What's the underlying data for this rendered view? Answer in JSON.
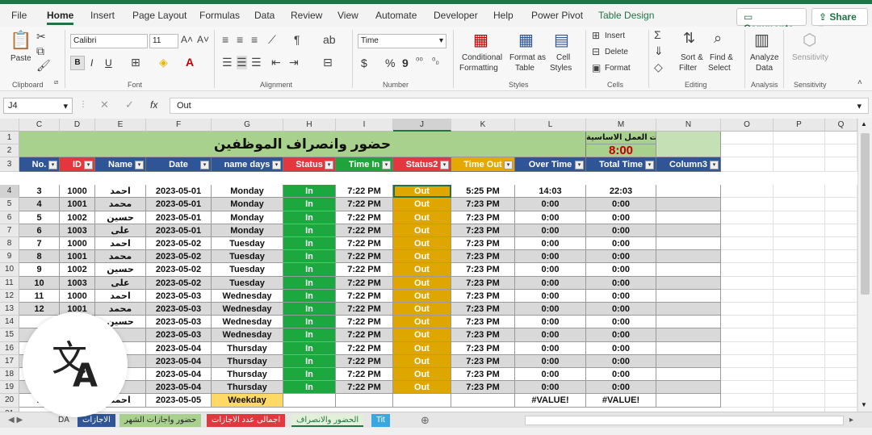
{
  "colors": {
    "brand": "#217346",
    "title_bg": "#a9d18e",
    "hdr_red": "#e2373f",
    "hdr_blue": "#2f5597",
    "hdr_green": "#1fa33a",
    "hdr_gold": "#e6a800",
    "in_green": "#1aa83f",
    "out_gold": "#e0a600",
    "pink": "#fbe3ea",
    "total_red": "#c00000"
  },
  "menu": {
    "tabs": [
      "File",
      "Home",
      "Insert",
      "Page Layout",
      "Formulas",
      "Data",
      "Review",
      "View",
      "Automate",
      "Developer",
      "Help",
      "Power Pivot",
      "Table Design"
    ],
    "comments": "Comments",
    "share": "Share"
  },
  "ribbon": {
    "clipboard": {
      "paste": "Paste",
      "label": "Clipboard"
    },
    "font": {
      "name": "Calibri",
      "size": "11",
      "label": "Font",
      "bold": "B",
      "italic": "I",
      "underline": "U"
    },
    "alignment": {
      "label": "Alignment"
    },
    "number": {
      "format": "Time",
      "currency": "$",
      "percent": "%",
      "comma": "9",
      "label": "Number"
    },
    "styles": {
      "conditional": "Conditional",
      "formatting": "Formatting",
      "format_as": "Format as",
      "table": "Table",
      "cell": "Cell",
      "cell_styles": "Styles",
      "label": "Styles"
    },
    "cells": {
      "insert": "Insert",
      "delete": "Delete",
      "format": "Format",
      "label": "Cells"
    },
    "editing": {
      "sort": "Sort &",
      "filter": "Filter",
      "find": "Find &",
      "select": "Select",
      "label": "Editing"
    },
    "analysis": {
      "analyze": "Analyze",
      "data": "Data",
      "label": "Analysis"
    },
    "sensitivity": {
      "name": "Sensitivity",
      "label": "Sensitivity"
    }
  },
  "formula_bar": {
    "name_box": "J4",
    "fx": "fx",
    "value": "Out"
  },
  "columns": [
    "C",
    "D",
    "E",
    "F",
    "G",
    "H",
    "I",
    "J",
    "K",
    "L",
    "M",
    "N",
    "O",
    "P",
    "Q"
  ],
  "sheet": {
    "title": "حضور وانصراف الموظفين",
    "total_label": "اجمالى ساعات العمل الاساسية",
    "total_value": "8:00",
    "headers": [
      "No.",
      "ID",
      "Name",
      "Date",
      "name days",
      "Status",
      "Time In",
      "Status2",
      "Time Out",
      "Over Time",
      "Total Time",
      "Column3"
    ],
    "rows": [
      {
        "r": "4",
        "no": "3",
        "id": "1000",
        "name": "احمد",
        "date": "2023-05-01",
        "day": "Monday",
        "status": "In",
        "tin": "7:22 PM",
        "status2": "Out",
        "tout": "5:25 PM",
        "over": "14:03",
        "total": "22:03"
      },
      {
        "r": "5",
        "no": "4",
        "id": "1001",
        "name": "محمد",
        "date": "2023-05-01",
        "day": "Monday",
        "status": "In",
        "tin": "7:22 PM",
        "status2": "Out",
        "tout": "7:23 PM",
        "over": "0:00",
        "total": "0:00"
      },
      {
        "r": "6",
        "no": "5",
        "id": "1002",
        "name": "حسين",
        "date": "2023-05-01",
        "day": "Monday",
        "status": "In",
        "tin": "7:22 PM",
        "status2": "Out",
        "tout": "7:23 PM",
        "over": "0:00",
        "total": "0:00"
      },
      {
        "r": "7",
        "no": "6",
        "id": "1003",
        "name": "على",
        "date": "2023-05-01",
        "day": "Monday",
        "status": "In",
        "tin": "7:22 PM",
        "status2": "Out",
        "tout": "7:23 PM",
        "over": "0:00",
        "total": "0:00"
      },
      {
        "r": "8",
        "no": "7",
        "id": "1000",
        "name": "احمد",
        "date": "2023-05-02",
        "day": "Tuesday",
        "status": "In",
        "tin": "7:22 PM",
        "status2": "Out",
        "tout": "7:23 PM",
        "over": "0:00",
        "total": "0:00"
      },
      {
        "r": "9",
        "no": "8",
        "id": "1001",
        "name": "محمد",
        "date": "2023-05-02",
        "day": "Tuesday",
        "status": "In",
        "tin": "7:22 PM",
        "status2": "Out",
        "tout": "7:23 PM",
        "over": "0:00",
        "total": "0:00"
      },
      {
        "r": "10",
        "no": "9",
        "id": "1002",
        "name": "حسين",
        "date": "2023-05-02",
        "day": "Tuesday",
        "status": "In",
        "tin": "7:22 PM",
        "status2": "Out",
        "tout": "7:23 PM",
        "over": "0:00",
        "total": "0:00"
      },
      {
        "r": "11",
        "no": "10",
        "id": "1003",
        "name": "على",
        "date": "2023-05-02",
        "day": "Tuesday",
        "status": "In",
        "tin": "7:22 PM",
        "status2": "Out",
        "tout": "7:23 PM",
        "over": "0:00",
        "total": "0:00"
      },
      {
        "r": "12",
        "no": "11",
        "id": "1000",
        "name": "احمد",
        "date": "2023-05-03",
        "day": "Wednesday",
        "status": "In",
        "tin": "7:22 PM",
        "status2": "Out",
        "tout": "7:23 PM",
        "over": "0:00",
        "total": "0:00"
      },
      {
        "r": "13",
        "no": "12",
        "id": "1001",
        "name": "محمد",
        "date": "2023-05-03",
        "day": "Wednesday",
        "status": "In",
        "tin": "7:22 PM",
        "status2": "Out",
        "tout": "7:23 PM",
        "over": "0:00",
        "total": "0:00"
      },
      {
        "r": "14",
        "no": "",
        "id": "",
        "name": "حسين",
        "date": "2023-05-03",
        "day": "Wednesday",
        "status": "In",
        "tin": "7:22 PM",
        "status2": "Out",
        "tout": "7:23 PM",
        "over": "0:00",
        "total": "0:00"
      },
      {
        "r": "15",
        "no": "",
        "id": "",
        "name": "",
        "date": "2023-05-03",
        "day": "Wednesday",
        "status": "In",
        "tin": "7:22 PM",
        "status2": "Out",
        "tout": "7:23 PM",
        "over": "0:00",
        "total": "0:00"
      },
      {
        "r": "16",
        "no": "",
        "id": "",
        "name": "",
        "date": "2023-05-04",
        "day": "Thursday",
        "status": "In",
        "tin": "7:22 PM",
        "status2": "Out",
        "tout": "7:23 PM",
        "over": "0:00",
        "total": "0:00"
      },
      {
        "r": "17",
        "no": "",
        "id": "",
        "name": "",
        "date": "2023-05-04",
        "day": "Thursday",
        "status": "In",
        "tin": "7:22 PM",
        "status2": "Out",
        "tout": "7:23 PM",
        "over": "0:00",
        "total": "0:00"
      },
      {
        "r": "18",
        "no": "",
        "id": "",
        "name": "",
        "date": "2023-05-04",
        "day": "Thursday",
        "status": "In",
        "tin": "7:22 PM",
        "status2": "Out",
        "tout": "7:23 PM",
        "over": "0:00",
        "total": "0:00"
      },
      {
        "r": "19",
        "no": "",
        "id": "",
        "name": "",
        "date": "2023-05-04",
        "day": "Thursday",
        "status": "In",
        "tin": "7:22 PM",
        "status2": "Out",
        "tout": "7:23 PM",
        "over": "0:00",
        "total": "0:00"
      },
      {
        "r": "20",
        "no": "1",
        "id": "",
        "name": "احمد",
        "date": "2023-05-05",
        "day": "Weekday",
        "status": "",
        "tin": "",
        "status2": "",
        "tout": "",
        "over": "#VALUE!",
        "total": "#VALUE!"
      }
    ]
  },
  "sheet_tabs": [
    "DA",
    "الاجازات",
    "حضور واجازات الشهر",
    "اجمالى عدد الاجازات",
    "الحضور والانصراف",
    "Tit"
  ]
}
